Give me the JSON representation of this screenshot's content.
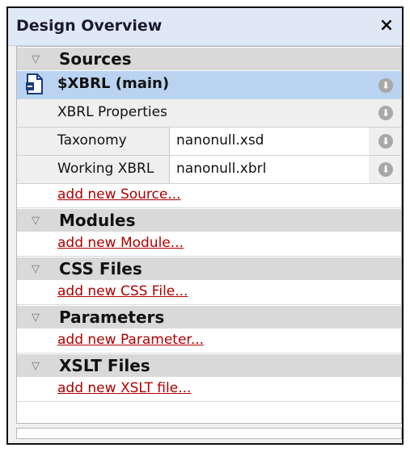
{
  "panel": {
    "title": "Design Overview",
    "close_glyph": "×",
    "close_icon": "close-icon"
  },
  "sections": {
    "sources": {
      "label": "Sources",
      "toggle": "▽"
    },
    "modules": {
      "label": "Modules",
      "toggle": "▽",
      "add": "add new Module..."
    },
    "css": {
      "label": "CSS Files",
      "toggle": "▽",
      "add": "add new CSS File..."
    },
    "parameters": {
      "label": "Parameters",
      "toggle": "▽",
      "add": "add new Parameter..."
    },
    "xslt": {
      "label": "XSLT Files",
      "toggle": "▽",
      "add": "add new XSLT file..."
    }
  },
  "sources": {
    "main": {
      "label": "$XBRL (main)",
      "icon": "xml-document-icon"
    },
    "properties": {
      "label": "XBRL Properties"
    },
    "taxonomy": {
      "key": "Taxonomy",
      "value": "nanonull.xsd"
    },
    "working": {
      "key": "Working XBRL",
      "value": "nanonull.xbrl"
    },
    "add": "add new Source..."
  },
  "icons": {
    "arrow_glyph": "⬇"
  },
  "colors": {
    "title_bg": "#dfe8f5",
    "section_bg": "#d9d9d9",
    "selected_bg": "#b9d3f0",
    "link": "#b00000"
  }
}
